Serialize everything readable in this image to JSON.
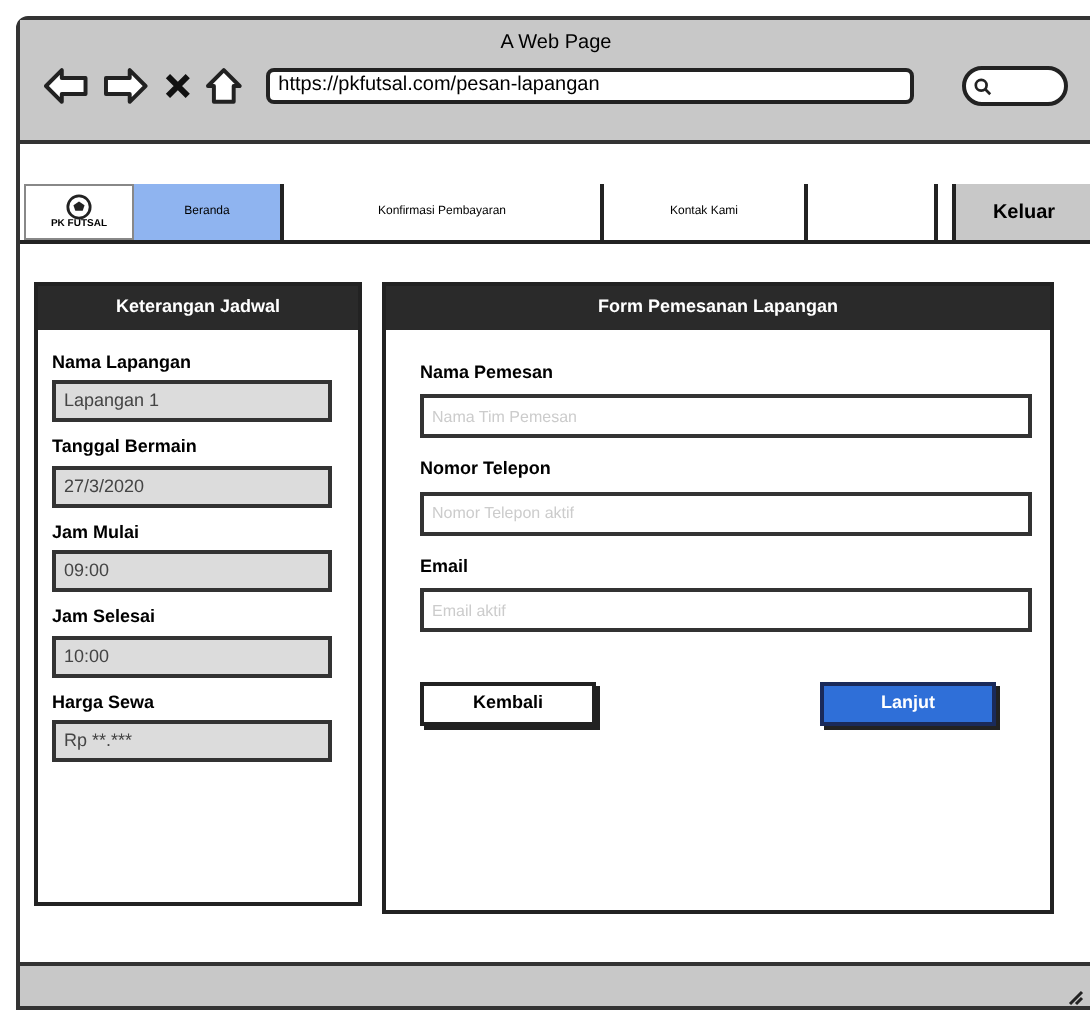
{
  "window": {
    "title": "A Web Page",
    "url": "https://pkfutsal.com/pesan-lapangan"
  },
  "nav": {
    "logo": "PK FUTSAL",
    "tabs": [
      {
        "label": "Beranda",
        "selected": true
      },
      {
        "label": "Konfirmasi Pembayaran",
        "selected": false
      },
      {
        "label": "Kontak Kami",
        "selected": false
      }
    ],
    "logout": "Keluar"
  },
  "schedule": {
    "title": "Keterangan Jadwal",
    "fields": [
      {
        "label": "Nama Lapangan",
        "value": "Lapangan 1"
      },
      {
        "label": "Tanggal Bermain",
        "value": "27/3/2020"
      },
      {
        "label": "Jam Mulai",
        "value": "09:00"
      },
      {
        "label": "Jam Selesai",
        "value": "10:00"
      },
      {
        "label": "Harga Sewa",
        "value": "Rp **.***"
      }
    ]
  },
  "form": {
    "title": "Form Pemesanan Lapangan",
    "fields": [
      {
        "label": "Nama Pemesan",
        "placeholder": "Nama Tim Pemesan"
      },
      {
        "label": "Nomor Telepon",
        "placeholder": "Nomor Telepon aktif"
      },
      {
        "label": "Email",
        "placeholder": "Email aktif"
      }
    ],
    "back": "Kembali",
    "next": "Lanjut"
  }
}
